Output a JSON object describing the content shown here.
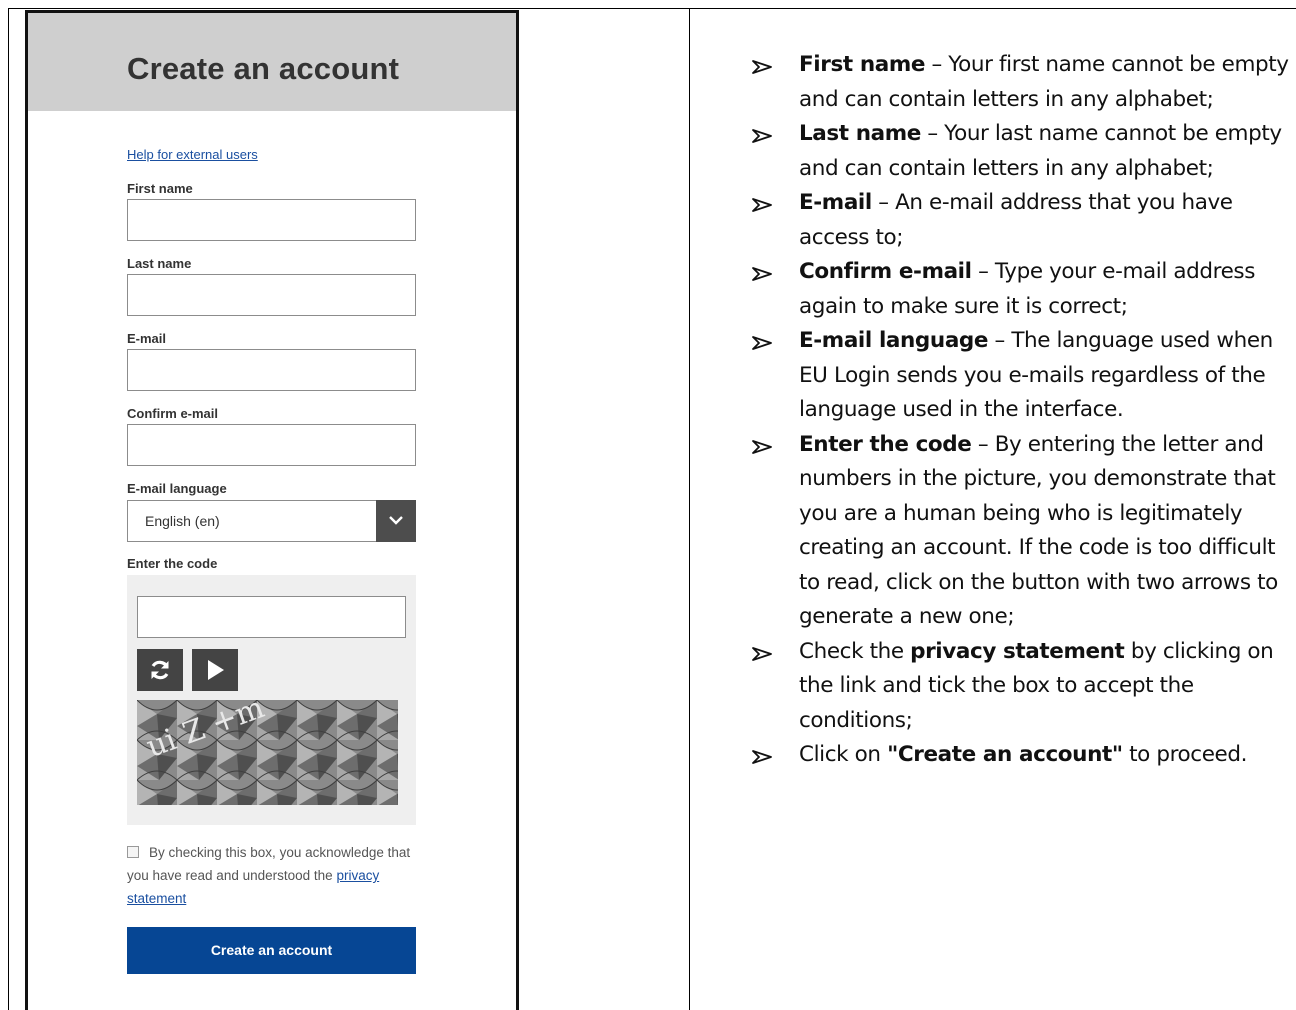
{
  "form": {
    "title": "Create an account",
    "help_link": "Help for external users",
    "first_name_label": "First name",
    "last_name_label": "Last name",
    "email_label": "E-mail",
    "confirm_email_label": "Confirm e-mail",
    "email_language_label": "E-mail language",
    "email_language_value": "English (en)",
    "code_label": "Enter the code",
    "captcha_text": "ui Z +m",
    "consent_text_1": "By checking this box, you acknowledge that you have read and understood the",
    "privacy_link": "privacy statement",
    "create_button": "Create an account"
  },
  "instructions": [
    {
      "bold": "First name",
      "text": " – Your first name cannot be empty and can contain letters in any alphabet;"
    },
    {
      "bold": "Last name",
      "text": " – Your last name cannot be empty and can contain letters in any alphabet;"
    },
    {
      "bold": "E-mail",
      "text": " – An e-mail address that you have access to;"
    },
    {
      "bold": "Confirm e-mail",
      "text": " – Type your e-mail address again to make sure it is correct;"
    },
    {
      "bold": "E-mail language",
      "text": " – The language used when EU Login sends you e-mails regardless of the language used in the interface."
    },
    {
      "bold": "Enter the code",
      "text": " – By entering the letter and numbers in the picture, you demonstrate that you are a human being who is legitimately creating an account. If the code is too difficult to read, click on the button with two arrows to generate a new one;"
    },
    {
      "pre": "Check the ",
      "bold": "privacy statement",
      "text": " by clicking on the link and tick the box to accept the conditions;"
    },
    {
      "pre": "Click on ",
      "bold": "\"Create an account\"",
      "text": " to proceed."
    }
  ],
  "icons": {
    "bullet": "arrowhead-icon",
    "refresh": "refresh-icon",
    "play": "play-icon",
    "dropdown": "chevron-down-icon"
  },
  "colors": {
    "header_bg": "#cfcfcf",
    "button_bg": "#064694",
    "link": "#1a4fa0"
  }
}
